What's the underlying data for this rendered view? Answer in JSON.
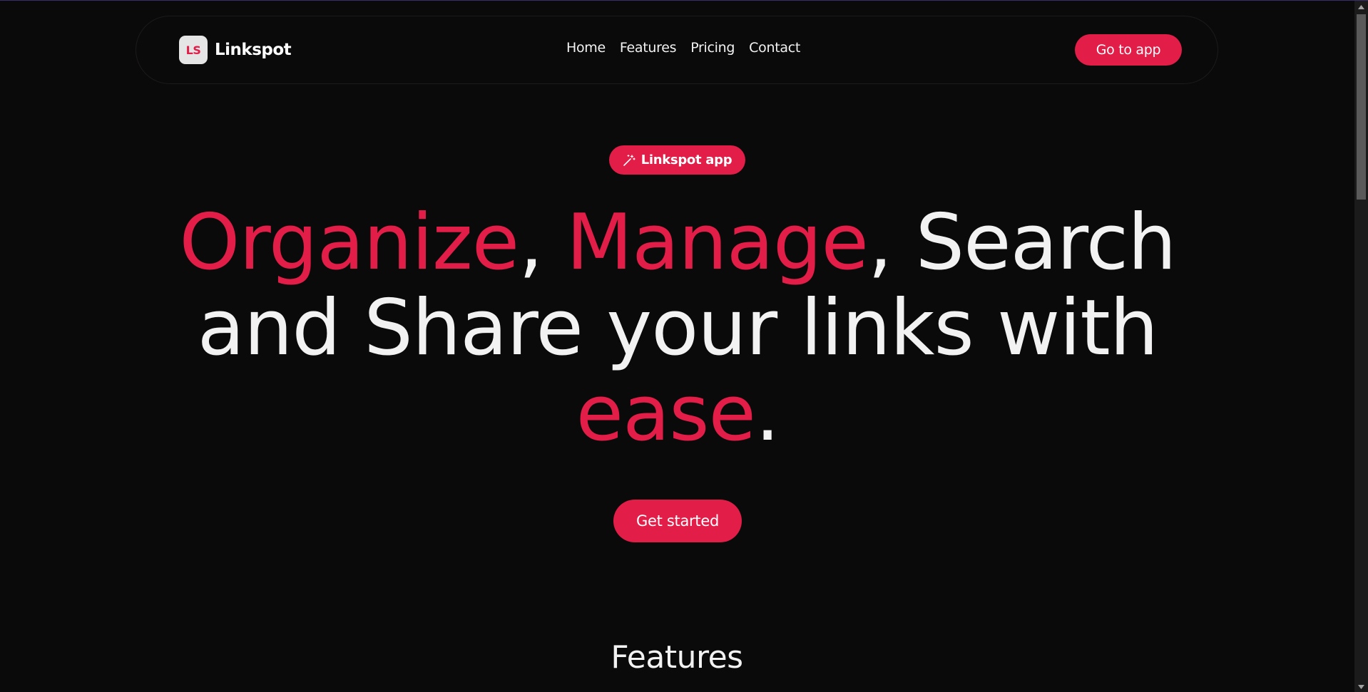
{
  "navbar": {
    "brand_logo_text": "LS",
    "brand_name": "Linkspot",
    "links": [
      "Home",
      "Features",
      "Pricing",
      "Contact"
    ],
    "go_to_app": "Go to app"
  },
  "hero": {
    "badge_label": "Linkspot app",
    "headline": {
      "w1": "Organize",
      "c1": ", ",
      "w2": "Manage",
      "c2": ", Search",
      "line2": "and Share your links with",
      "w3": "ease",
      "end": "."
    },
    "cta_label": "Get started"
  },
  "features": {
    "title": "Features"
  },
  "colors": {
    "accent": "#e11d48",
    "background": "#0b0a0a",
    "text": "#f2f2f2",
    "logo_bg": "#e5e5e5"
  },
  "icons": {
    "badge_icon": "magic-wand-icon",
    "scroll_up": "scroll-up-arrow-icon",
    "scroll_down": "scroll-down-arrow-icon"
  }
}
